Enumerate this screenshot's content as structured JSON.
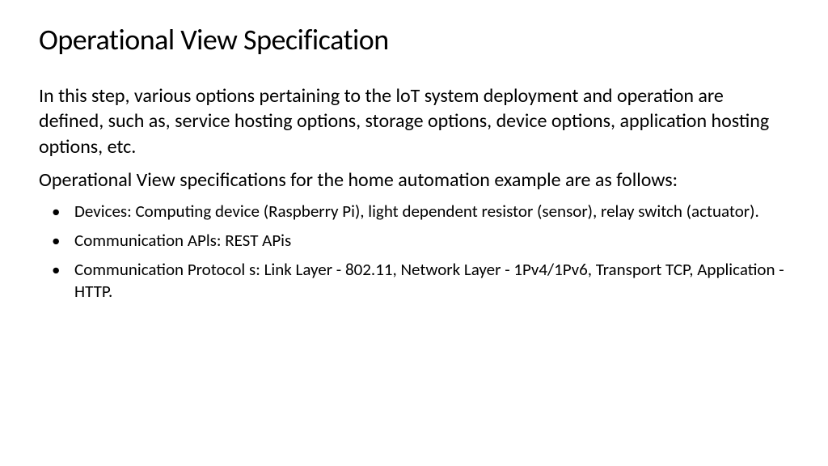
{
  "title": "Operational View Specification",
  "paragraphs": [
    "In this step, various options pertaining  to the loT system deployment and operation are defined, such as, service hosting options, storage options, device options, application hosting options, etc.",
    "Operational View specifications for the home automation example are as follows:"
  ],
  "bullets": [
    "Devices: Computing device (Raspberry Pi), light dependent resistor (sensor), relay switch (actuator).",
    "Communication APls: REST APis",
    "Communication Protocol s: Link Layer - 802.11, Network Layer - 1Pv4/1Pv6, Transport TCP, Application - HTTP."
  ]
}
